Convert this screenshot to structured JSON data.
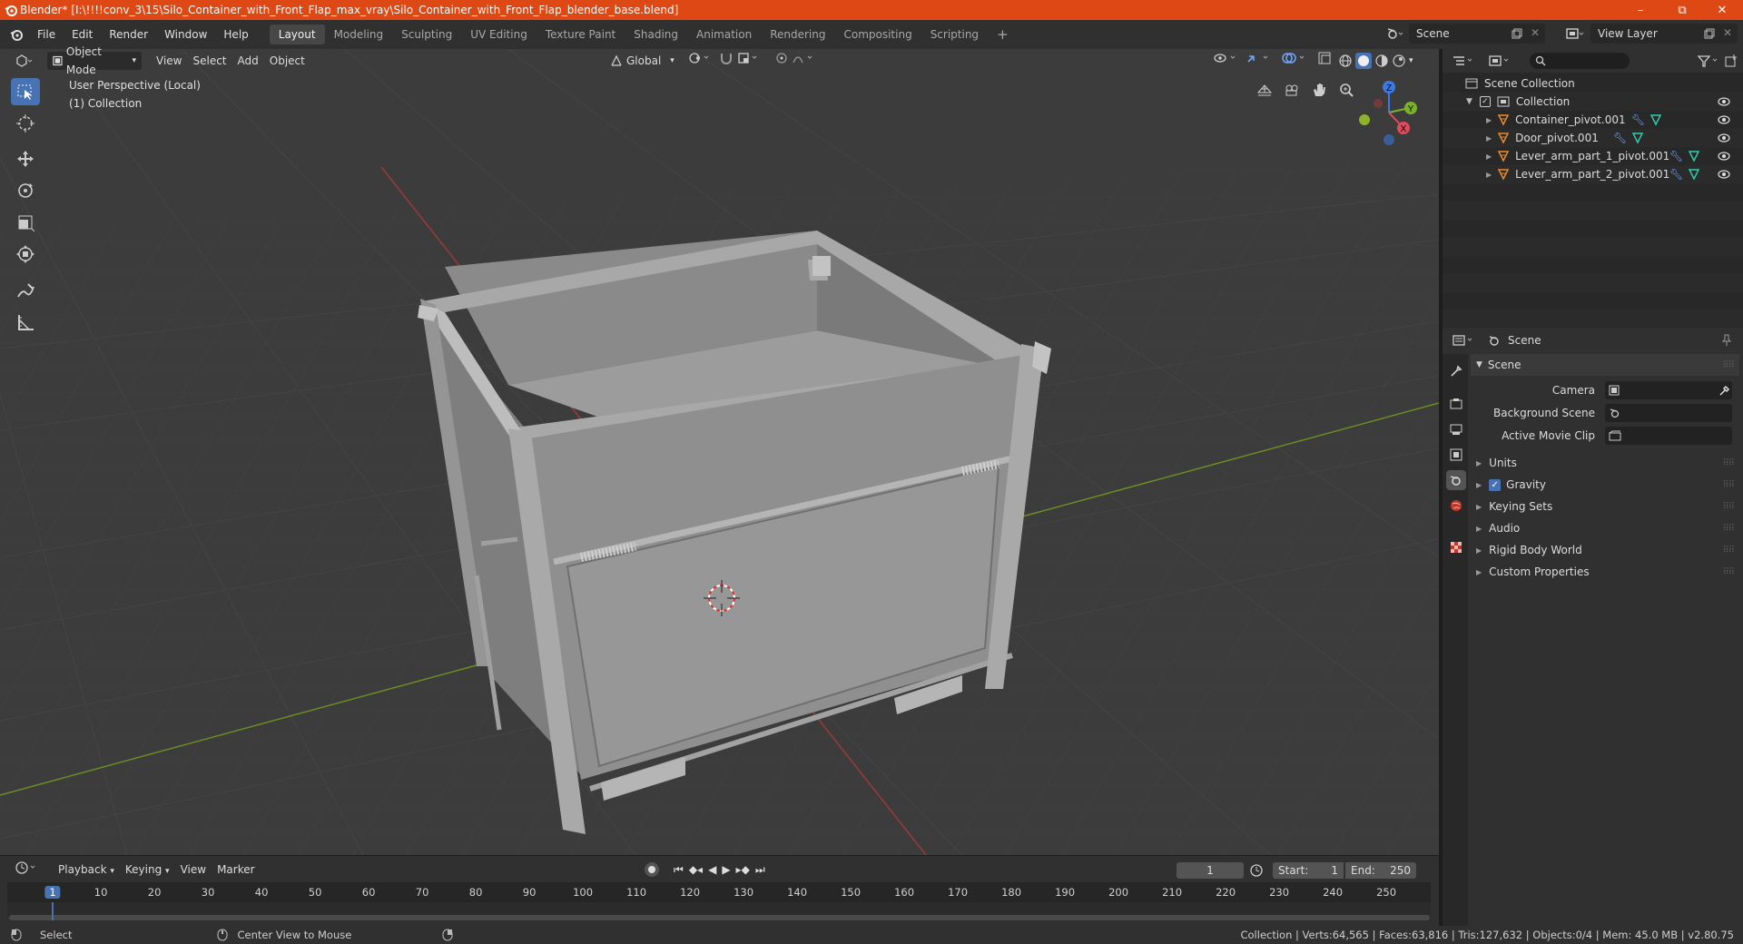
{
  "window": {
    "title": "Blender* [I:\\!!!!conv_3\\15\\Silo_Container_with_Front_Flap_max_vray\\Silo_Container_with_Front_Flap_blender_base.blend]",
    "minimize": "–",
    "maximize": "⧉",
    "close": "✕"
  },
  "menubar": {
    "menus": [
      "File",
      "Edit",
      "Render",
      "Window",
      "Help"
    ],
    "workspaces": [
      "Layout",
      "Modeling",
      "Sculpting",
      "UV Editing",
      "Texture Paint",
      "Shading",
      "Animation",
      "Rendering",
      "Compositing",
      "Scripting"
    ],
    "active_workspace": "Layout",
    "add_workspace": "+",
    "scene_name": "Scene",
    "view_layer_name": "View Layer"
  },
  "viewport": {
    "mode": "Object Mode",
    "menus": [
      "View",
      "Select",
      "Add",
      "Object"
    ],
    "orientation": "Global",
    "perspective_label": "User Perspective (Local)",
    "collection_label": "(1) Collection",
    "gizmo_axes": {
      "x": "X",
      "y": "Y",
      "z": "Z"
    },
    "colors": {
      "x_axis": "#9b3a3a",
      "y_axis": "#6b8e23",
      "background": "#3c3c3c"
    }
  },
  "timeline": {
    "menus": [
      "Playback",
      "Keying",
      "View",
      "Marker"
    ],
    "current_frame": "1",
    "start_label": "Start:",
    "start_value": "1",
    "end_label": "End:",
    "end_value": "250",
    "ticks": [
      "1",
      "10",
      "20",
      "30",
      "40",
      "50",
      "60",
      "70",
      "80",
      "90",
      "100",
      "110",
      "120",
      "130",
      "140",
      "150",
      "160",
      "170",
      "180",
      "190",
      "200",
      "210",
      "220",
      "230",
      "240",
      "250"
    ]
  },
  "statusbar": {
    "select": "Select",
    "center_view": "Center View to Mouse",
    "stats": "Collection | Verts:64,565 | Faces:63,816 | Tris:127,632 | Objects:0/4 | Mem: 45.0 MB | v2.80.75"
  },
  "outliner": {
    "search_placeholder": "",
    "scene_collection": "Scene Collection",
    "collection": "Collection",
    "objects": [
      {
        "name": "Container_pivot.001"
      },
      {
        "name": "Door_pivot.001"
      },
      {
        "name": "Lever_arm_part_1_pivot.001"
      },
      {
        "name": "Lever_arm_part_2_pivot.001"
      }
    ]
  },
  "properties": {
    "context": "Scene",
    "panel_title": "Scene",
    "camera_label": "Camera",
    "background_scene_label": "Background Scene",
    "active_movie_clip_label": "Active Movie Clip",
    "sections": [
      "Units",
      "Gravity",
      "Keying Sets",
      "Audio",
      "Rigid Body World",
      "Custom Properties"
    ],
    "gravity_checked": true
  }
}
